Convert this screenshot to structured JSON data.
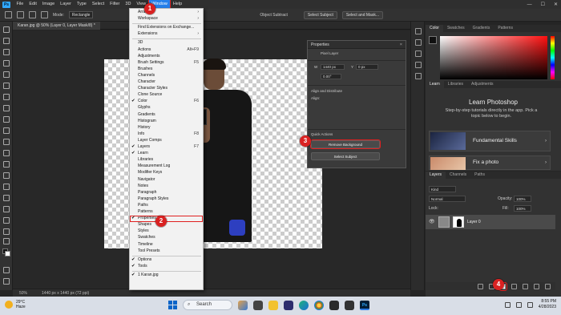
{
  "app": {
    "logo": "Ps"
  },
  "menubar": {
    "items": [
      "File",
      "Edit",
      "Image",
      "Layer",
      "Type",
      "Select",
      "Filter",
      "3D",
      "View",
      "Window",
      "Help"
    ]
  },
  "options": {
    "mode_label": "Mode:",
    "mode_value": "Rectangle",
    "obj_subtract": "Object Subtract",
    "select_subject": "Select Subject",
    "select_mask": "Select and Mask..."
  },
  "document": {
    "tab_title": "Karan.jpg @ 50% (Layer 0, Layer Mask/8) *",
    "zoom": "50%",
    "size": "1440 px x 1440 px (72 ppi)"
  },
  "window_menu": {
    "items": [
      {
        "label": "Arrange",
        "shortcut": "",
        "checked": false,
        "submenu": true
      },
      {
        "label": "Workspace",
        "shortcut": "",
        "checked": false,
        "submenu": true
      },
      {
        "label": "Find Extensions on Exchange...",
        "shortcut": "",
        "checked": false,
        "submenu": false
      },
      {
        "label": "Extensions",
        "shortcut": "",
        "checked": false,
        "submenu": true
      },
      {
        "label": "3D",
        "shortcut": "",
        "checked": false,
        "submenu": false
      },
      {
        "label": "Actions",
        "shortcut": "Alt+F9",
        "checked": false,
        "submenu": false
      },
      {
        "label": "Adjustments",
        "shortcut": "",
        "checked": false,
        "submenu": false
      },
      {
        "label": "Brush Settings",
        "shortcut": "F5",
        "checked": false,
        "submenu": false
      },
      {
        "label": "Brushes",
        "shortcut": "",
        "checked": false,
        "submenu": false
      },
      {
        "label": "Channels",
        "shortcut": "",
        "checked": false,
        "submenu": false
      },
      {
        "label": "Character",
        "shortcut": "",
        "checked": false,
        "submenu": false
      },
      {
        "label": "Character Styles",
        "shortcut": "",
        "checked": false,
        "submenu": false
      },
      {
        "label": "Clone Source",
        "shortcut": "",
        "checked": false,
        "submenu": false
      },
      {
        "label": "Color",
        "shortcut": "F6",
        "checked": true,
        "submenu": false
      },
      {
        "label": "Glyphs",
        "shortcut": "",
        "checked": false,
        "submenu": false
      },
      {
        "label": "Gradients",
        "shortcut": "",
        "checked": false,
        "submenu": false
      },
      {
        "label": "Histogram",
        "shortcut": "",
        "checked": false,
        "submenu": false
      },
      {
        "label": "History",
        "shortcut": "",
        "checked": false,
        "submenu": false
      },
      {
        "label": "Info",
        "shortcut": "F8",
        "checked": false,
        "submenu": false
      },
      {
        "label": "Layer Comps",
        "shortcut": "",
        "checked": false,
        "submenu": false
      },
      {
        "label": "Layers",
        "shortcut": "F7",
        "checked": true,
        "submenu": false
      },
      {
        "label": "Learn",
        "shortcut": "",
        "checked": true,
        "submenu": false
      },
      {
        "label": "Libraries",
        "shortcut": "",
        "checked": false,
        "submenu": false
      },
      {
        "label": "Measurement Log",
        "shortcut": "",
        "checked": false,
        "submenu": false
      },
      {
        "label": "Modifier Keys",
        "shortcut": "",
        "checked": false,
        "submenu": false
      },
      {
        "label": "Navigator",
        "shortcut": "",
        "checked": false,
        "submenu": false
      },
      {
        "label": "Notes",
        "shortcut": "",
        "checked": false,
        "submenu": false
      },
      {
        "label": "Paragraph",
        "shortcut": "",
        "checked": false,
        "submenu": false
      },
      {
        "label": "Paragraph Styles",
        "shortcut": "",
        "checked": false,
        "submenu": false
      },
      {
        "label": "Paths",
        "shortcut": "",
        "checked": false,
        "submenu": false
      },
      {
        "label": "Patterns",
        "shortcut": "",
        "checked": false,
        "submenu": false
      },
      {
        "label": "Properties",
        "shortcut": "",
        "checked": true,
        "submenu": false
      },
      {
        "label": "Shapes",
        "shortcut": "",
        "checked": false,
        "submenu": false
      },
      {
        "label": "Styles",
        "shortcut": "",
        "checked": false,
        "submenu": false
      },
      {
        "label": "Swatches",
        "shortcut": "",
        "checked": false,
        "submenu": false
      },
      {
        "label": "Timeline",
        "shortcut": "",
        "checked": false,
        "submenu": false
      },
      {
        "label": "Tool Presets",
        "shortcut": "",
        "checked": false,
        "submenu": false
      },
      {
        "label": "Options",
        "shortcut": "",
        "checked": true,
        "submenu": false
      },
      {
        "label": "Tools",
        "shortcut": "",
        "checked": true,
        "submenu": false
      },
      {
        "label": "1 Karan.jpg",
        "shortcut": "",
        "checked": true,
        "submenu": false
      }
    ],
    "check_glyph": "✔",
    "arrow_glyph": "›"
  },
  "properties": {
    "title": "Properties",
    "close": "×",
    "layer_type": "Pixel Layer",
    "w_label": "W",
    "w_value": "1440 px",
    "y_label": "Y",
    "y_value": "0 px",
    "angle_value": "0.00°",
    "align_heading": "Align and Distribute",
    "align_label": "Align:",
    "quick_actions": "Quick Actions",
    "remove_bg": "Remove Background",
    "select_subject": "Select Subject"
  },
  "color_panel": {
    "tabs": [
      "Color",
      "Swatches",
      "Gradients",
      "Patterns"
    ]
  },
  "learn_panel": {
    "tabs": [
      "Learn",
      "Libraries",
      "Adjustments"
    ],
    "title": "Learn Photoshop",
    "subtitle": "Step-by-step tutorials directly in the app. Pick a topic below to begin.",
    "cards": [
      "Fundamental Skills",
      "Fix a photo"
    ],
    "arrow": "›"
  },
  "layers_panel": {
    "tabs": [
      "Layers",
      "Channels",
      "Paths"
    ],
    "kind": "Kind",
    "blend_mode": "Normal",
    "opacity_label": "Opacity:",
    "opacity_value": "100%",
    "lock_label": "Lock:",
    "fill_label": "Fill:",
    "fill_value": "100%",
    "layer_name": "Layer 0",
    "eye": "👁"
  },
  "badges": [
    "1",
    "2",
    "3",
    "4"
  ],
  "taskbar": {
    "temp": "29°C",
    "condition": "Haze",
    "search": "Search",
    "search_glyph": "⌕",
    "ps_label": "Ps",
    "time": "8:55 PM",
    "date": "4/28/2023"
  },
  "colors": {
    "accent": "#2680eb",
    "badge": "#d92222",
    "glove": "#2d3fc0"
  }
}
